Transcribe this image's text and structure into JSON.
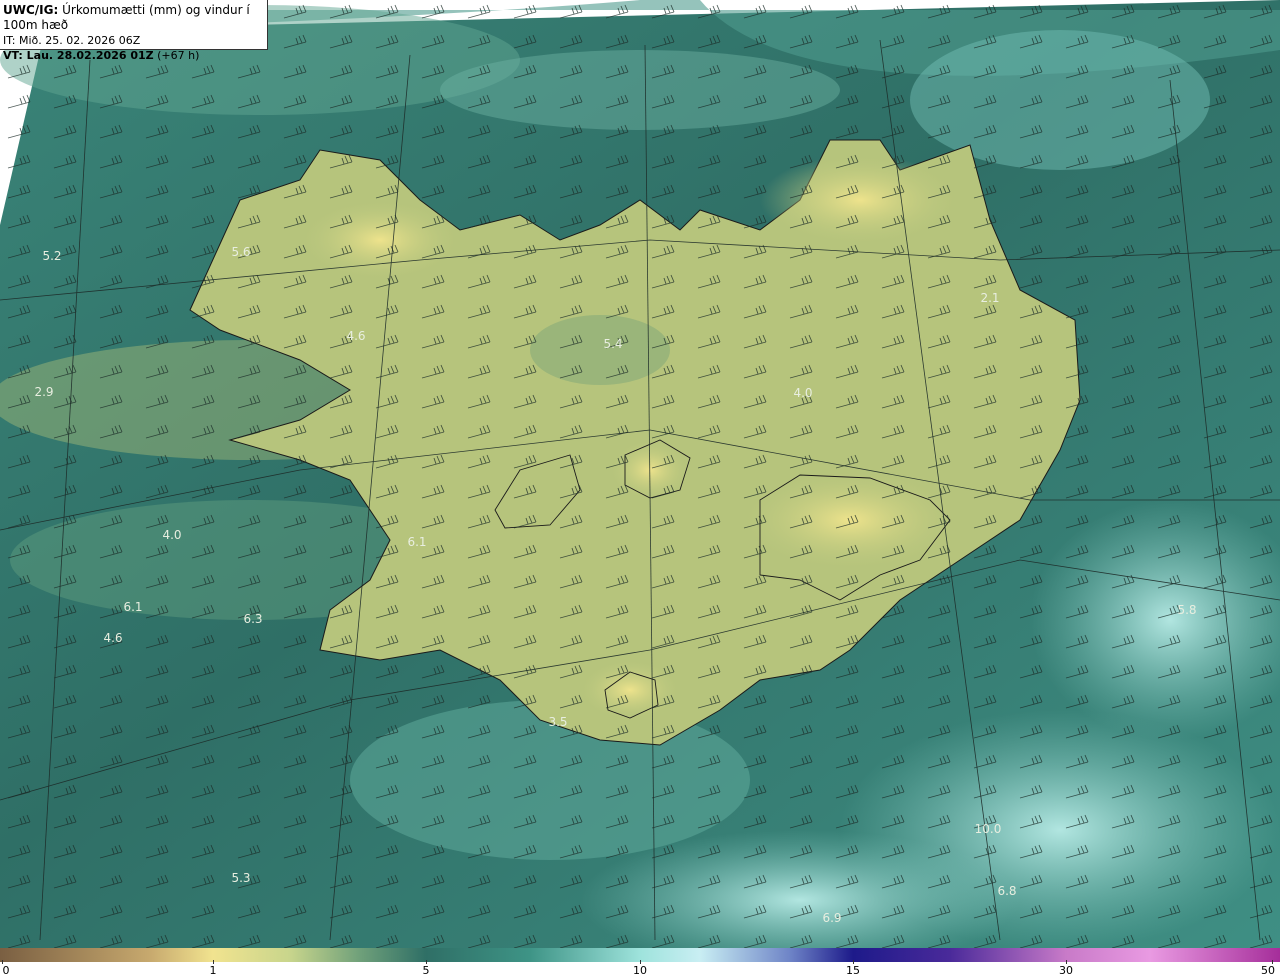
{
  "header": {
    "product": "UWC/IG:",
    "title": "Úrkomumætti (mm) og vindur í 100m hæð",
    "initial_time": "IT: Mið. 25. 02. 2026 06Z",
    "valid_time": "VT: Lau. 28.02.2026 01Z",
    "lead": "(+67 h)"
  },
  "colorbar": {
    "ticks": [
      "0",
      "1",
      "5",
      "10",
      "15",
      "30",
      "50"
    ]
  },
  "value_labels": [
    "5.2",
    "5.6",
    "4.6",
    "5.4",
    "4.0",
    "2.9",
    "4.0",
    "6.1",
    "6.1",
    "6.3",
    "4.6",
    "5.8",
    "5.3",
    "6.8",
    "6.9",
    "10.0",
    "2.1",
    "3.5"
  ],
  "colors": {
    "sea_dark": "#2f6f66",
    "sea_mid": "#3e9486",
    "land": "#b9c77f",
    "land_high": "#e6df8c",
    "light_cyan": "#a9e2dc"
  }
}
